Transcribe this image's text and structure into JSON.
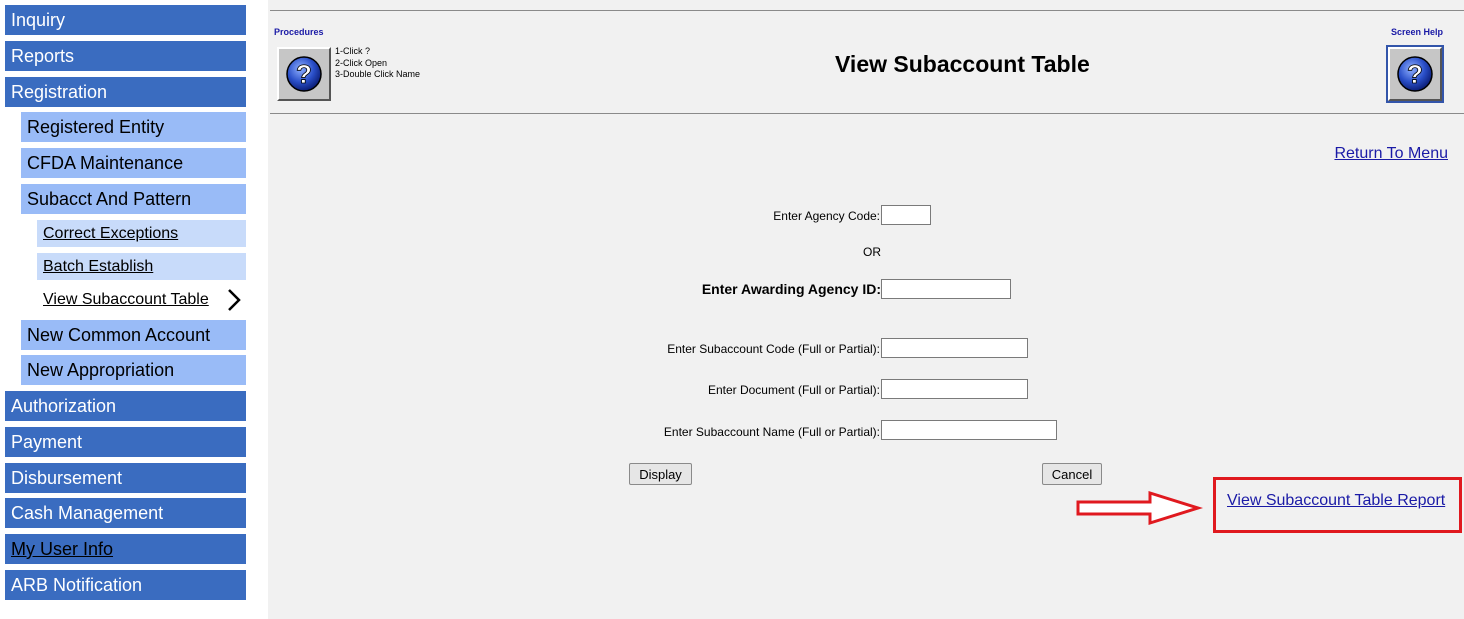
{
  "sidebar": {
    "items": [
      {
        "label": "Inquiry"
      },
      {
        "label": "Reports"
      },
      {
        "label": "Registration"
      },
      {
        "label": "Registered Entity"
      },
      {
        "label": "CFDA Maintenance"
      },
      {
        "label": "Subacct And Pattern"
      },
      {
        "label": "Correct Exceptions"
      },
      {
        "label": "Batch Establish"
      },
      {
        "label": "View Subaccount Table"
      },
      {
        "label": "New Common Account"
      },
      {
        "label": "New Appropriation"
      },
      {
        "label": "Authorization"
      },
      {
        "label": "Payment"
      },
      {
        "label": "Disbursement"
      },
      {
        "label": "Cash Management"
      },
      {
        "label": "My User Info"
      },
      {
        "label": "ARB Notification"
      }
    ]
  },
  "header": {
    "procedures_label": "Procedures",
    "steps": [
      "1-Click ?",
      "2-Click Open",
      "3-Double Click Name"
    ],
    "title": "View Subaccount Table",
    "screen_help_label": "Screen Help"
  },
  "links": {
    "return_to_menu": "Return To Menu",
    "report": "View Subaccount Table Report"
  },
  "form": {
    "agency_code_label": "Enter Agency Code:",
    "agency_code_value": "",
    "or_label": "OR",
    "awarding_agency_label": "Enter Awarding Agency ID:",
    "awarding_agency_value": "",
    "subaccount_code_label": "Enter Subaccount Code (Full or Partial):",
    "subaccount_code_value": "",
    "document_label": "Enter Document (Full or Partial):",
    "document_value": "",
    "subaccount_name_label": "Enter Subaccount Name (Full or Partial):",
    "subaccount_name_value": "",
    "display_button": "Display",
    "cancel_button": "Cancel"
  },
  "colors": {
    "nav_primary": "#3a6cc0",
    "nav_secondary": "#99bbf7",
    "nav_tertiary": "#c8dbfa",
    "highlight": "#e0191f",
    "link": "#1a1aa6"
  }
}
